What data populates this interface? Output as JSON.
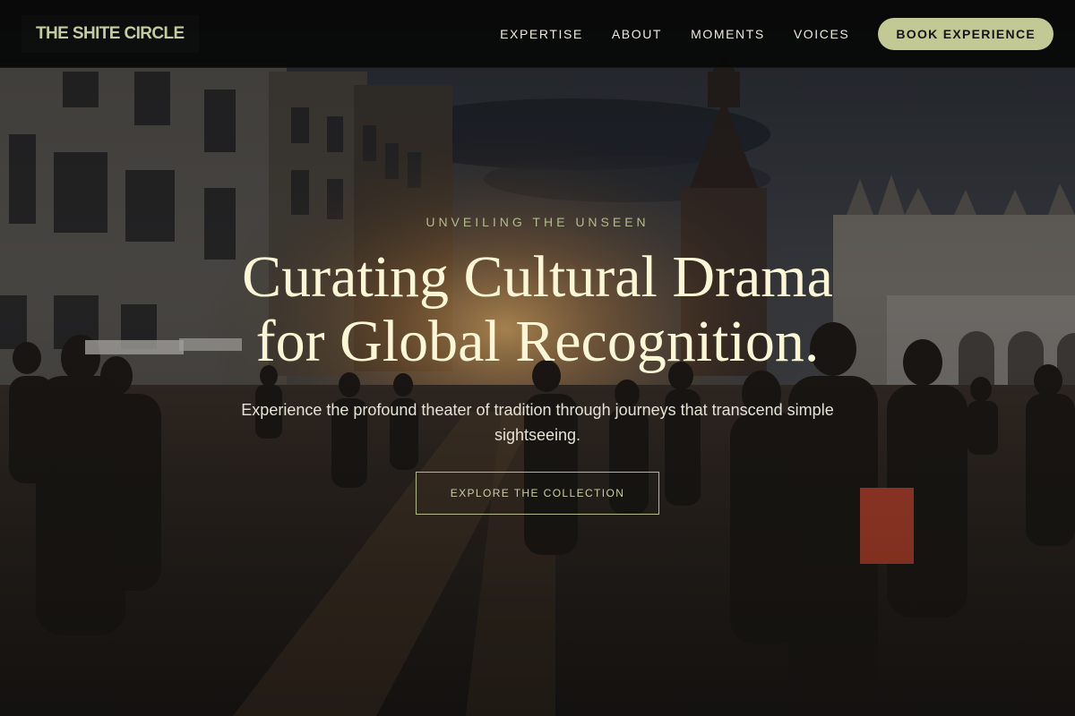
{
  "brand": {
    "name": "THE SHITE CIRCLE"
  },
  "nav": {
    "items": [
      {
        "label": "EXPERTISE"
      },
      {
        "label": "ABOUT"
      },
      {
        "label": "MOMENTS"
      },
      {
        "label": "VOICES"
      }
    ],
    "cta_label": "BOOK EXPERIENCE"
  },
  "hero": {
    "eyebrow": "UNVEILING THE UNSEEN",
    "headline_line1": "Curating Cultural Drama",
    "headline_line2": "for Global Recognition.",
    "subtext": "Experience the profound theater of tradition through journeys that transcend simple sightseeing.",
    "button_label": "EXPLORE THE COLLECTION",
    "background": "old-town-market-square-at-sunset-with-crowd"
  },
  "colors": {
    "accent": "#c2c994",
    "headline": "#fbf6d6",
    "header_bg": "#080808",
    "eyebrow": "#b4b98e"
  }
}
